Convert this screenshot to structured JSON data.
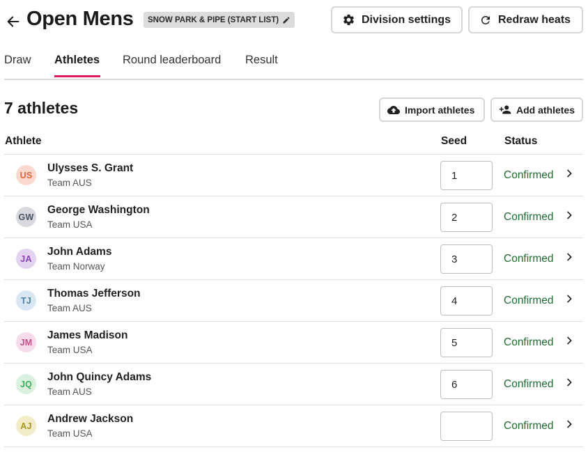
{
  "header": {
    "title": "Open Mens",
    "event_chip": "SNOW PARK & PIPE (START LIST)",
    "division_settings_label": "Division settings",
    "redraw_heats_label": "Redraw heats"
  },
  "tabs": [
    {
      "label": "Draw",
      "active": false
    },
    {
      "label": "Athletes",
      "active": true
    },
    {
      "label": "Round leaderboard",
      "active": false
    },
    {
      "label": "Result",
      "active": false
    }
  ],
  "toolbar": {
    "count_label": "7 athletes",
    "import_label": "Import athletes",
    "add_label": "Add athletes"
  },
  "table": {
    "columns": [
      "Athlete",
      "Seed",
      "Status"
    ],
    "rows": [
      {
        "initials": "US",
        "name": "Ulysses S. Grant",
        "team": "Team AUS",
        "seed": "1",
        "status": "Confirmed",
        "avatar_bg": "#fbd9cf",
        "avatar_fg": "#e2643e"
      },
      {
        "initials": "GW",
        "name": "George Washington",
        "team": "Team USA",
        "seed": "2",
        "status": "Confirmed",
        "avatar_bg": "#d7d9de",
        "avatar_fg": "#4a5260"
      },
      {
        "initials": "JA",
        "name": "John Adams",
        "team": "Team Norway",
        "seed": "3",
        "status": "Confirmed",
        "avatar_bg": "#e3d3f0",
        "avatar_fg": "#8a3fb8"
      },
      {
        "initials": "TJ",
        "name": "Thomas Jefferson",
        "team": "Team AUS",
        "seed": "4",
        "status": "Confirmed",
        "avatar_bg": "#d8e7f3",
        "avatar_fg": "#4d7ea6"
      },
      {
        "initials": "JM",
        "name": "James Madison",
        "team": "Team USA",
        "seed": "5",
        "status": "Confirmed",
        "avatar_bg": "#f6dcea",
        "avatar_fg": "#c54e8c"
      },
      {
        "initials": "JQ",
        "name": "John Quincy Adams",
        "team": "Team AUS",
        "seed": "6",
        "status": "Confirmed",
        "avatar_bg": "#d9f1de",
        "avatar_fg": "#3fae5a"
      },
      {
        "initials": "AJ",
        "name": "Andrew Jackson",
        "team": "Team USA",
        "seed": "",
        "status": "Confirmed",
        "avatar_bg": "#f2ecc8",
        "avatar_fg": "#a99421"
      }
    ]
  },
  "colors": {
    "accent": "#e0185e",
    "status_confirmed": "#1f6b32"
  },
  "icons": {
    "back": "arrow-left-icon",
    "edit": "pencil-icon",
    "settings": "gear-icon",
    "redraw": "refresh-icon",
    "import": "cloud-upload-icon",
    "add": "person-add-icon",
    "row": "chevron-right-icon"
  }
}
